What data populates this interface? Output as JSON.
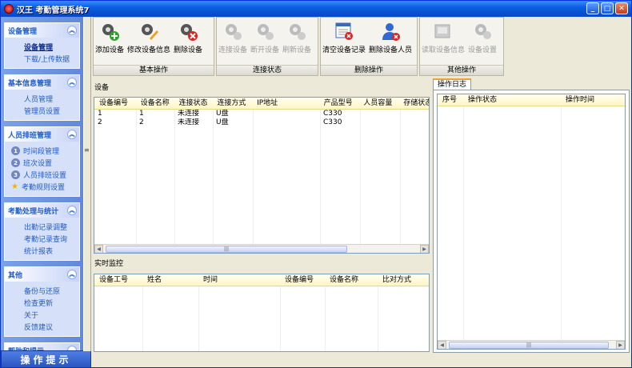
{
  "window": {
    "title": "汉王 考勤管理系统7"
  },
  "sidebar": {
    "groups": [
      {
        "title": "设备管理",
        "items": [
          {
            "label": "设备管理",
            "active": true
          },
          {
            "label": "下载/上传数据"
          }
        ]
      },
      {
        "title": "基本信息管理",
        "items": [
          {
            "label": "人员管理"
          },
          {
            "label": "管理员设置"
          }
        ]
      },
      {
        "title": "人员排班管理",
        "items": [
          {
            "num": "1",
            "label": "时间段管理"
          },
          {
            "num": "2",
            "label": "班次设置"
          },
          {
            "num": "3",
            "label": "人员排班设置"
          },
          {
            "num": "★",
            "label": "考勤规则设置"
          }
        ]
      },
      {
        "title": "考勤处理与统计",
        "items": [
          {
            "label": "出勤记录调整"
          },
          {
            "label": "考勤记录查询"
          },
          {
            "label": "统计报表"
          }
        ]
      },
      {
        "title": "其他",
        "items": [
          {
            "label": "备份与还原"
          },
          {
            "label": "检查更新"
          },
          {
            "label": "关于"
          },
          {
            "label": "反馈建议"
          }
        ]
      },
      {
        "title": "帮助和提示"
      }
    ],
    "bottom_button": "操作提示"
  },
  "toolbar": {
    "groups": [
      {
        "label": "基本操作",
        "buttons": [
          {
            "label": "添加设备",
            "icon": "gear-add-icon",
            "enabled": true
          },
          {
            "label": "修改设备信息",
            "icon": "gear-edit-icon",
            "enabled": true
          },
          {
            "label": "删除设备",
            "icon": "gear-delete-icon",
            "enabled": true
          }
        ]
      },
      {
        "label": "连接状态",
        "buttons": [
          {
            "label": "连接设备",
            "icon": "gear-connect-icon",
            "enabled": false
          },
          {
            "label": "断开设备",
            "icon": "gear-disconnect-icon",
            "enabled": false
          },
          {
            "label": "刷新设备",
            "icon": "gear-refresh-icon",
            "enabled": false
          }
        ]
      },
      {
        "label": "删除操作",
        "buttons": [
          {
            "label": "清空设备记录",
            "icon": "clear-records-icon",
            "enabled": true
          },
          {
            "label": "删除设备人员",
            "icon": "delete-user-icon",
            "enabled": true
          }
        ]
      },
      {
        "label": "其他操作",
        "buttons": [
          {
            "label": "读取设备信息",
            "icon": "read-device-icon",
            "enabled": false
          },
          {
            "label": "设备设置",
            "icon": "device-settings-icon",
            "enabled": false
          }
        ]
      }
    ]
  },
  "devices": {
    "label": "设备",
    "columns": [
      "设备编号",
      "设备名称",
      "连接状态",
      "连接方式",
      "IP地址",
      "产品型号",
      "人员容量",
      "存储状态"
    ],
    "rows": [
      [
        "1",
        "1",
        "未连接",
        "U盘",
        "",
        "C330",
        "",
        ""
      ],
      [
        "2",
        "2",
        "未连接",
        "U盘",
        "",
        "C330",
        "",
        ""
      ]
    ]
  },
  "monitor": {
    "label": "实时监控",
    "columns": [
      "设备工号",
      "姓名",
      "时间",
      "设备编号",
      "设备名称",
      "比对方式"
    ]
  },
  "log": {
    "tab_label": "操作日志",
    "columns": [
      "序号",
      "操作状态",
      "操作时间"
    ]
  },
  "colors": {
    "accent": "#215dc6",
    "header_bg": "#fff6c2",
    "title_bar": "#0a5ee0"
  }
}
